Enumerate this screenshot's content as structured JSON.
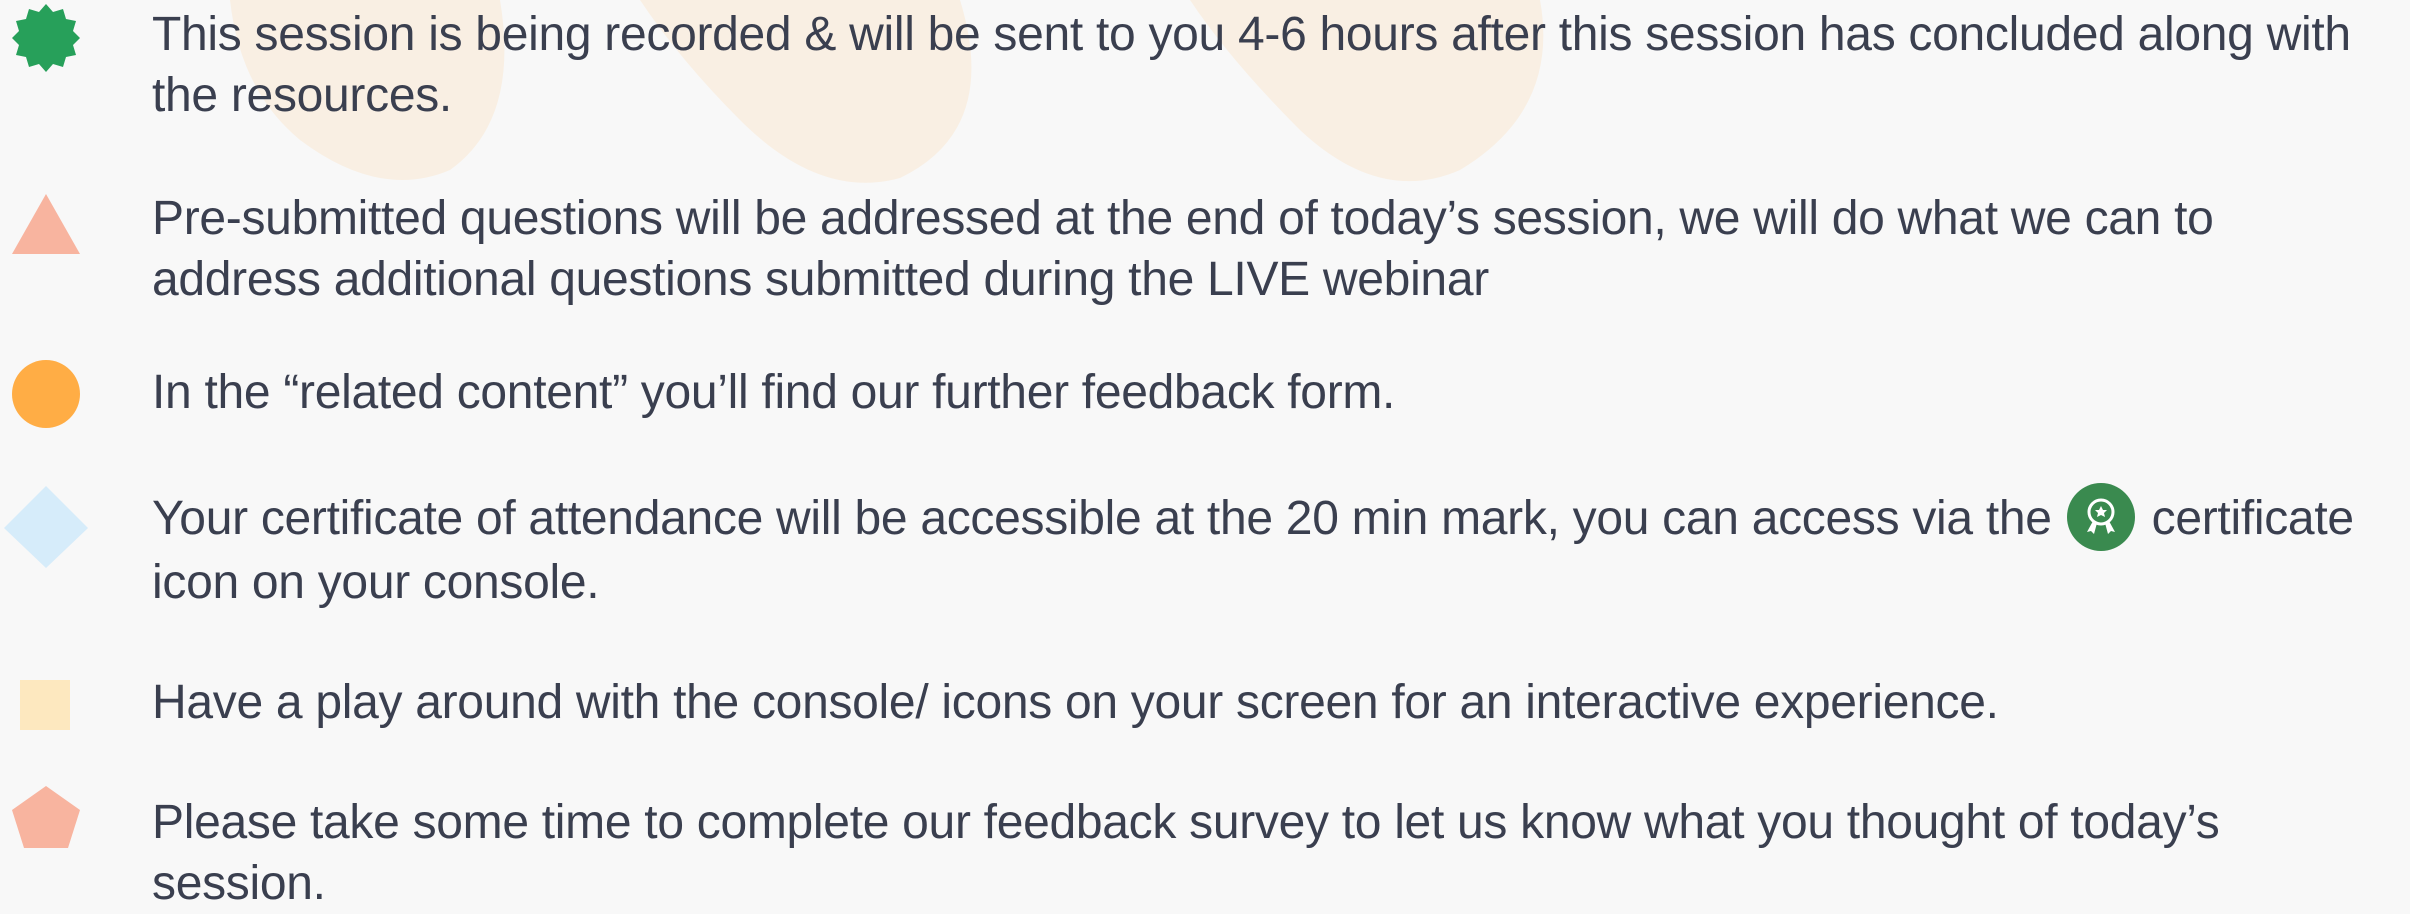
{
  "colors": {
    "background": "#f8f8f8",
    "text": "#3a3f4f",
    "decor": "#f9efe3",
    "green": "#27a05a",
    "salmon": "#f8b49f",
    "orange": "#ffad45",
    "light_blue": "#d6ecfa",
    "light_yellow": "#fde8bf",
    "certificate_badge": "#3a8a4f"
  },
  "bullets": [
    {
      "icon": "green-badge-icon",
      "text": "This session is being recorded & will be sent to you 4-6 hours after this session has concluded along with the resources."
    },
    {
      "icon": "salmon-triangle-icon",
      "text": "Pre-submitted questions will be addressed at the end of today’s session, we will do what we can to address additional questions submitted during the LIVE webinar"
    },
    {
      "icon": "orange-circle-icon",
      "text": "In the “related content” you’ll find our further feedback form."
    },
    {
      "icon": "blue-diamond-icon",
      "text_before": "Your certificate of attendance will be accessible at the 20 min mark, you can access via the",
      "inline_icon": "certificate-icon",
      "text_after": "certificate icon on your console."
    },
    {
      "icon": "yellow-square-icon",
      "text": "Have a play around with the console/ icons on your screen for an interactive experience."
    },
    {
      "icon": "salmon-pentagon-icon",
      "text": "Please take some time to complete our feedback survey to let us know what you thought of today’s session."
    }
  ]
}
